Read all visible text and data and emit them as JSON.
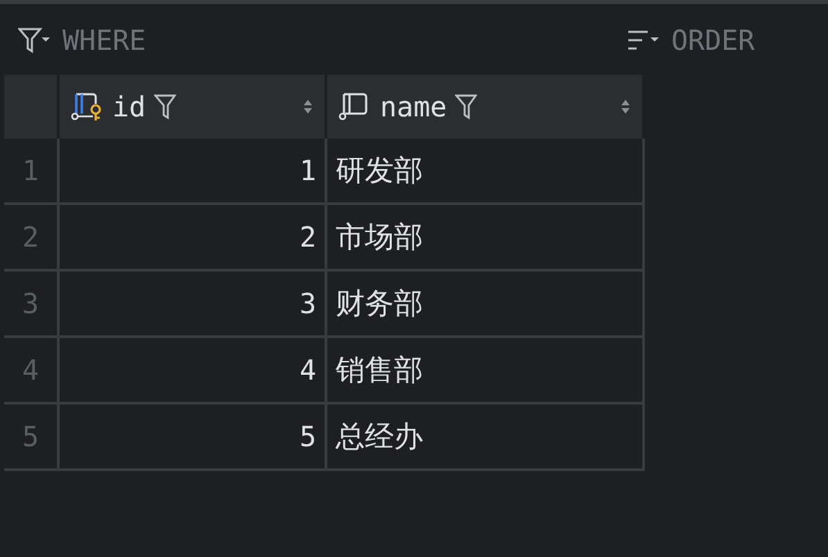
{
  "filter_bar": {
    "where_label": "WHERE",
    "order_label": "ORDER"
  },
  "table": {
    "columns": [
      {
        "name": "id",
        "kind": "key"
      },
      {
        "name": "name",
        "kind": "plain"
      }
    ],
    "rows": [
      {
        "number": "1",
        "cells": [
          "1",
          "研发部"
        ]
      },
      {
        "number": "2",
        "cells": [
          "2",
          "市场部"
        ]
      },
      {
        "number": "3",
        "cells": [
          "3",
          "财务部"
        ]
      },
      {
        "number": "4",
        "cells": [
          "4",
          "销售部"
        ]
      },
      {
        "number": "5",
        "cells": [
          "5",
          "总经办"
        ]
      }
    ]
  }
}
